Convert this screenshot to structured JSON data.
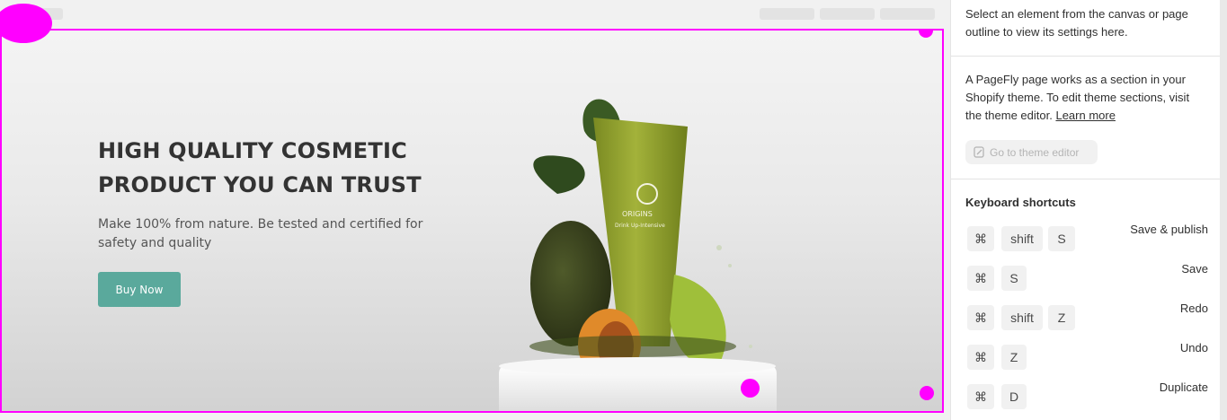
{
  "hero": {
    "title": "HIGH QUALITY COSMETIC PRODUCT YOU CAN TRUST",
    "subtitle": "Make 100% from nature. Be tested and certified for safety and quality",
    "button_label": "Buy Now",
    "button_color": "#5aa99c",
    "product_brand": "ORIGINS",
    "product_name": "Drink Up-Intensive"
  },
  "selection_color": "#ff00ff",
  "panel": {
    "select_hint": "Select an element from the canvas or page outline to view its settings here.",
    "info_text": "A PageFly page works as a section in your Shopify theme. To edit theme sections, visit the theme editor.",
    "learn_more": "Learn more",
    "theme_editor_button": "Go to theme editor",
    "shortcuts_title": "Keyboard shortcuts",
    "shortcuts": [
      {
        "keys": [
          "⌘",
          "shift",
          "S"
        ],
        "label": "Save & publish"
      },
      {
        "keys": [
          "⌘",
          "S"
        ],
        "label": "Save"
      },
      {
        "keys": [
          "⌘",
          "shift",
          "Z"
        ],
        "label": "Redo"
      },
      {
        "keys": [
          "⌘",
          "Z"
        ],
        "label": "Undo"
      },
      {
        "keys": [
          "⌘",
          "D"
        ],
        "label": "Duplicate"
      }
    ]
  }
}
